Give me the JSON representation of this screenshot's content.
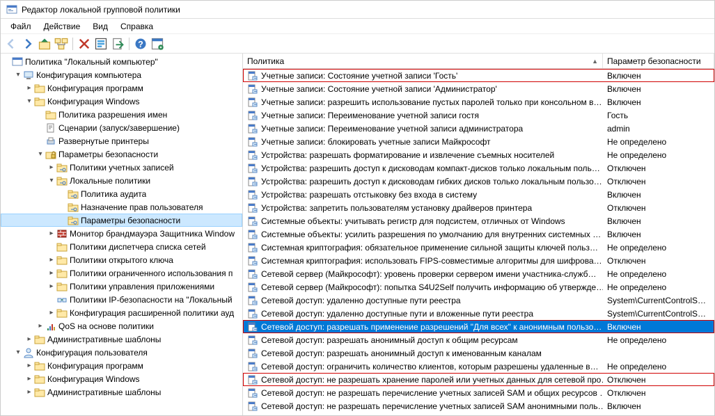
{
  "window_title": "Редактор локальной групповой политики",
  "menubar": [
    "Файл",
    "Действие",
    "Вид",
    "Справка"
  ],
  "toolbar_icons": [
    "back",
    "forward",
    "up",
    "folder-tree",
    "delete",
    "refresh",
    "export",
    "help",
    "props"
  ],
  "columns": {
    "policy_header": "Политика",
    "value_header": "Параметр безопасности",
    "sort_indicator": "▲"
  },
  "tree_root_label": "Политика \"Локальный компьютер\"",
  "tree": [
    {
      "label": "Конфигурация компьютера",
      "icon": "computer",
      "exp": "v",
      "indent": 1,
      "children": [
        {
          "label": "Конфигурация программ",
          "icon": "folder",
          "exp": ">",
          "indent": 2
        },
        {
          "label": "Конфигурация Windows",
          "icon": "folder",
          "exp": "v",
          "indent": 2,
          "children": [
            {
              "label": "Политика разрешения имен",
              "icon": "folder",
              "exp": "",
              "indent": 3
            },
            {
              "label": "Сценарии (запуск/завершение)",
              "icon": "script",
              "exp": "",
              "indent": 3
            },
            {
              "label": "Развернутые принтеры",
              "icon": "printer",
              "exp": "",
              "indent": 3
            },
            {
              "label": "Параметры безопасности",
              "icon": "lock",
              "exp": "v",
              "indent": 3,
              "children": [
                {
                  "label": "Политики учетных записей",
                  "icon": "folder-key",
                  "exp": ">",
                  "indent": 4
                },
                {
                  "label": "Локальные политики",
                  "icon": "folder-key",
                  "exp": "v",
                  "indent": 4,
                  "children": [
                    {
                      "label": "Политика аудита",
                      "icon": "folder-key",
                      "exp": "",
                      "indent": 5
                    },
                    {
                      "label": "Назначение прав пользователя",
                      "icon": "folder-key",
                      "exp": "",
                      "indent": 5
                    },
                    {
                      "label": "Параметры безопасности",
                      "icon": "folder-key",
                      "exp": "",
                      "indent": 5,
                      "selected": true
                    }
                  ]
                },
                {
                  "label": "Монитор брандмауэра Защитника Window",
                  "icon": "firewall",
                  "exp": ">",
                  "indent": 4
                },
                {
                  "label": "Политики диспетчера списка сетей",
                  "icon": "folder",
                  "exp": "",
                  "indent": 4
                },
                {
                  "label": "Политики открытого ключа",
                  "icon": "folder",
                  "exp": ">",
                  "indent": 4
                },
                {
                  "label": "Политики ограниченного использования п",
                  "icon": "folder",
                  "exp": ">",
                  "indent": 4
                },
                {
                  "label": "Политики управления приложениями",
                  "icon": "folder",
                  "exp": ">",
                  "indent": 4
                },
                {
                  "label": "Политики IP-безопасности на \"Локальный",
                  "icon": "ipsec",
                  "exp": "",
                  "indent": 4
                },
                {
                  "label": "Конфигурация расширенной политики ауд",
                  "icon": "folder",
                  "exp": ">",
                  "indent": 4
                }
              ]
            },
            {
              "label": "QoS на основе политики",
              "icon": "qos",
              "exp": ">",
              "indent": 3
            }
          ]
        },
        {
          "label": "Административные шаблоны",
          "icon": "folder",
          "exp": ">",
          "indent": 2
        }
      ]
    },
    {
      "label": "Конфигурация пользователя",
      "icon": "user",
      "exp": "v",
      "indent": 1,
      "children": [
        {
          "label": "Конфигурация программ",
          "icon": "folder",
          "exp": ">",
          "indent": 2
        },
        {
          "label": "Конфигурация Windows",
          "icon": "folder",
          "exp": ">",
          "indent": 2
        },
        {
          "label": "Административные шаблоны",
          "icon": "folder",
          "exp": ">",
          "indent": 2
        }
      ]
    }
  ],
  "policies": [
    {
      "name": "Учетные записи: Состояние учетной записи 'Гость'",
      "value": "Включен",
      "hl": "red"
    },
    {
      "name": "Учетные записи: Состояние учетной записи 'Администратор'",
      "value": "Включен"
    },
    {
      "name": "Учетные записи: разрешить использование пустых паролей только при консольном в…",
      "value": "Включен"
    },
    {
      "name": "Учетные записи: Переименование учетной записи гостя",
      "value": "Гость"
    },
    {
      "name": "Учетные записи: Переименование учетной записи администратора",
      "value": "admin"
    },
    {
      "name": "Учетные записи: блокировать учетные записи Майкрософт",
      "value": "Не определено"
    },
    {
      "name": "Устройства: разрешать форматирование и извлечение съемных носителей",
      "value": "Не определено"
    },
    {
      "name": "Устройства: разрешить доступ к дисководам компакт-дисков только локальным поль…",
      "value": "Отключен"
    },
    {
      "name": "Устройства: разрешить доступ к дисководам гибких дисков только локальным пользо…",
      "value": "Отключен"
    },
    {
      "name": "Устройства: разрешать отстыковку без входа в систему",
      "value": "Включен"
    },
    {
      "name": "Устройства: запретить пользователям установку драйверов принтера",
      "value": "Отключен"
    },
    {
      "name": "Системные объекты: учитывать регистр для подсистем, отличных от Windows",
      "value": "Включен"
    },
    {
      "name": "Системные объекты: усилить разрешения по умолчанию для внутренних системных …",
      "value": "Включен"
    },
    {
      "name": "Системная криптография: обязательное применение сильной защиты ключей польз…",
      "value": "Не определено"
    },
    {
      "name": "Системная криптография: использовать FIPS-совместимые алгоритмы для шифрова…",
      "value": "Отключен"
    },
    {
      "name": "Сетевой сервер (Майкрософт): уровень проверки сервером имени участника-служб…",
      "value": "Не определено"
    },
    {
      "name": "Сетевой сервер (Майкрософт): попытка S4U2Self получить информацию об утвержде…",
      "value": "Не определено"
    },
    {
      "name": "Сетевой доступ: удаленно доступные пути реестра",
      "value": "System\\CurrentControlS…"
    },
    {
      "name": "Сетевой доступ: удаленно доступные пути и вложенные пути реестра",
      "value": "System\\CurrentControlS…"
    },
    {
      "name": "Сетевой доступ: разрешать применение разрешений \"Для всех\" к анонимным пользо…",
      "value": "Включен",
      "hl": "red",
      "selected": true
    },
    {
      "name": "Сетевой доступ: разрешать анонимный доступ к общим ресурсам",
      "value": "Не определено"
    },
    {
      "name": "Сетевой доступ: разрешать анонимный доступ к именованным каналам",
      "value": ""
    },
    {
      "name": "Сетевой доступ: ограничить количество клиентов, которым разрешены удаленные в…",
      "value": "Не определено"
    },
    {
      "name": "Сетевой доступ: не разрешать хранение паролей или учетных данных для сетевой про…",
      "value": "Отключен",
      "hl": "red"
    },
    {
      "name": "Сетевой доступ: не разрешать перечисление учетных записей SAM и общих ресурсов …",
      "value": "Отключен"
    },
    {
      "name": "Сетевой доступ: не разрешать перечисление учетных записей SAM анонимными поль…",
      "value": "Включен"
    }
  ]
}
